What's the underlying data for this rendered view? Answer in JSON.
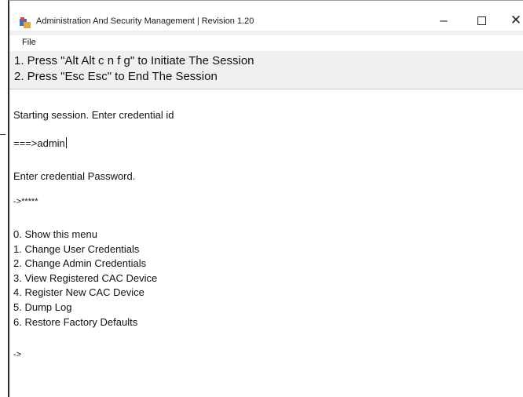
{
  "window": {
    "title": "Administration And Security Management  |  Revision 1.20",
    "controls": {
      "minimize": "–",
      "close": "✕"
    }
  },
  "menu": {
    "file": "File"
  },
  "instructions": [
    "1. Press \"Alt Alt c n f g\" to Initiate The Session",
    "2. Press \"Esc Esc\" to End The Session"
  ],
  "console": {
    "starting": "Starting session. Enter credential id",
    "id_prompt": "===>admin",
    "password_prompt": "Enter credential Password.",
    "password_entry": "->*****",
    "menu_items": [
      "0.  Show this menu",
      "1.  Change User Credentials",
      "2.  Change Admin Credentials",
      "3.  View Registered CAC Device",
      "4.  Register New CAC Device",
      "5.  Dump Log",
      "6.  Restore Factory Defaults"
    ],
    "final_prompt": "->"
  },
  "icons": {
    "app": "app-icon"
  }
}
